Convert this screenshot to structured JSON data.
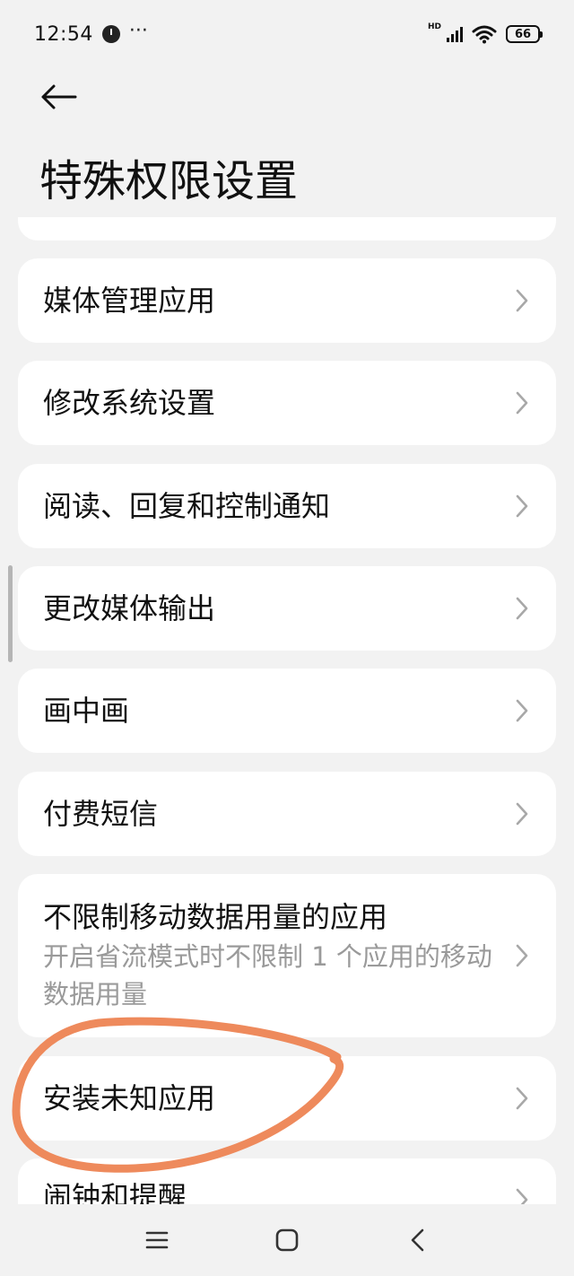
{
  "status_bar": {
    "time": "12:54",
    "more": "···",
    "hd": "HD",
    "battery": "66"
  },
  "header": {
    "title": "特殊权限设置"
  },
  "items": [
    {
      "title": "媒体管理应用"
    },
    {
      "title": "修改系统设置"
    },
    {
      "title": "阅读、回复和控制通知"
    },
    {
      "title": "更改媒体输出"
    },
    {
      "title": "画中画"
    },
    {
      "title": "付费短信"
    },
    {
      "title": "不限制移动数据用量的应用",
      "subtitle": "开启省流模式时不限制 1 个应用的移动数据用量"
    },
    {
      "title": "安装未知应用"
    },
    {
      "title": "闹钟和提醒"
    }
  ],
  "colors": {
    "background": "#f2f2f2",
    "card": "#ffffff",
    "annotation": "#ee8a5c"
  }
}
